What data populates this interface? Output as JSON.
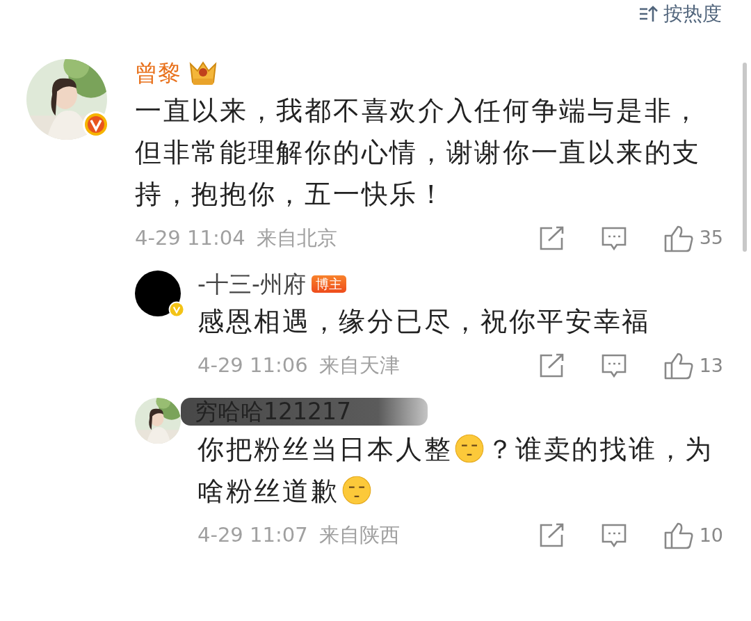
{
  "sort": {
    "label": "按热度"
  },
  "comments": [
    {
      "user": "曾黎",
      "vip": true,
      "crown": true,
      "verified": true,
      "avatar": {
        "kind": "picture"
      },
      "content": [
        {
          "kind": "text",
          "text": "一直以来，我都不喜欢介入任何争端与是非，但非常能理解你的心情，谢谢你一直以来的支持，抱抱你，五一快乐！"
        }
      ],
      "time": "4-29 11:04",
      "location": "来自北京",
      "likes": "35",
      "replies": [
        {
          "user": "-十三-州府",
          "vip": false,
          "tag": "博主",
          "verified": true,
          "avatar": {
            "kind": "blank"
          },
          "content": [
            {
              "kind": "text",
              "text": "感恩相遇，缘分已尽，祝你平安幸福"
            }
          ],
          "time": "4-29 11:06",
          "location": "来自天津",
          "likes": "13"
        },
        {
          "user": "穷哈哈121217",
          "vip": false,
          "redacted": true,
          "verified": false,
          "avatar": {
            "kind": "picture"
          },
          "content": [
            {
              "kind": "text",
              "text": "你把粉丝当日本人整"
            },
            {
              "kind": "emoji"
            },
            {
              "kind": "text",
              "text": "？谁卖的找谁，为"
            },
            {
              "kind": "text",
              "text": "啥粉丝道歉"
            },
            {
              "kind": "emoji"
            }
          ],
          "time": "4-29 11:07",
          "location": "来自陕西",
          "likes": "10"
        }
      ]
    }
  ]
}
